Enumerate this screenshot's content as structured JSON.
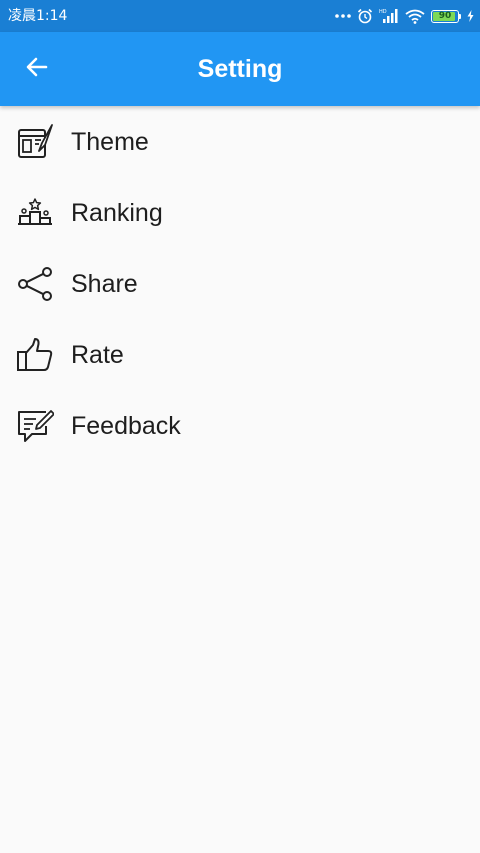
{
  "status_bar": {
    "time": "凌晨1:14",
    "battery_level": "90",
    "icons": [
      "more-dots-icon",
      "alarm-icon",
      "hd-signal-icon",
      "wifi-icon",
      "battery-icon",
      "charging-icon"
    ]
  },
  "app_bar": {
    "title": "Setting",
    "back_icon": "arrow-left-icon",
    "color": "#2196f3"
  },
  "menu": {
    "items": [
      {
        "label": "Theme",
        "icon": "theme-palette-icon"
      },
      {
        "label": "Ranking",
        "icon": "ranking-podium-icon"
      },
      {
        "label": "Share",
        "icon": "share-icon"
      },
      {
        "label": "Rate",
        "icon": "thumbs-up-icon"
      },
      {
        "label": "Feedback",
        "icon": "feedback-edit-icon"
      }
    ]
  }
}
